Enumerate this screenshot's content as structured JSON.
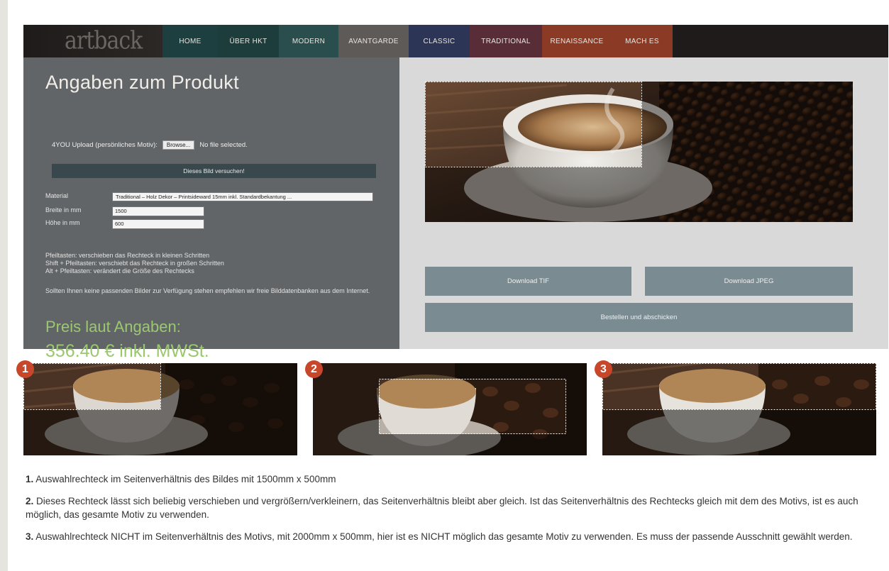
{
  "nav": {
    "logo": "artback",
    "items": [
      {
        "label": "HOME",
        "color": "#1d3f40"
      },
      {
        "label": "ÜBER HKT",
        "color": "#1d3c3c"
      },
      {
        "label": "MODERN",
        "color": "#2a4e4d"
      },
      {
        "label": "AVANTGARDE",
        "color": "#5e5a57"
      },
      {
        "label": "CLASSIC",
        "color": "#2c3556"
      },
      {
        "label": "TRADITIONAL",
        "color": "#592d38"
      },
      {
        "label": "RENAISSANCE",
        "color": "#8b3a26"
      },
      {
        "label": "MACH ES",
        "color": "#8b3a26"
      }
    ]
  },
  "form": {
    "title": "Angaben zum Produkt",
    "upload_label": "4YOU Upload (persönliches Motiv):",
    "browse_label": "Browse...",
    "no_file": "No file selected.",
    "upload_button": "Dieses Bild versuchen!",
    "material_label": "Material",
    "material_value": "Traditional – Holz Dekor – Printsideward 15mm inkl. Standardbekantung ...",
    "width_label": "Breite in mm",
    "width_value": "1500",
    "height_label": "Höhe in mm",
    "height_value": "600",
    "hint1": "Pfeiltasten: verschieben das Rechteck in kleinen Schritten",
    "hint2": "Shift + Pfeiltasten: verschiebt das Rechteck in großen Schritten",
    "hint3": "Alt + Pfeiltasten: verändert die Größe des Rechtecks",
    "hint4": "Sollten Ihnen keine passenden Bilder zur Verfügung stehen empfehlen wir freie Bilddatenbanken aus dem Internet.",
    "price_label": "Preis laut Angaben:",
    "price_value": "356.40 € inkl. MWSt."
  },
  "buttons": {
    "download_tif": "Download TIF",
    "download_jpeg": "Download JPEG",
    "order": "Bestellen und abschicken"
  },
  "badges": [
    "1",
    "2",
    "3"
  ],
  "descriptions": [
    {
      "num": "1.",
      "text": " Auswahlrechteck im Seitenverhältnis des Bildes mit 1500mm x 500mm"
    },
    {
      "num": "2.",
      "text": " Dieses Rechteck lässt sich beliebig verschieben und vergrößern/verkleinern, das Seitenverhältnis bleibt aber gleich. Ist das Seitenverhältnis des Rechtecks gleich mit dem des Motivs, ist es auch möglich, das gesamte Motiv zu verwenden."
    },
    {
      "num": "3.",
      "text": " Auswahlrechteck NICHT im Seitenverhältnis des Motivs, mit 2000mm x 500mm, hier ist es NICHT möglich das gesamte Motiv zu verwenden. Es muss der passende Ausschnitt gewählt werden."
    }
  ]
}
